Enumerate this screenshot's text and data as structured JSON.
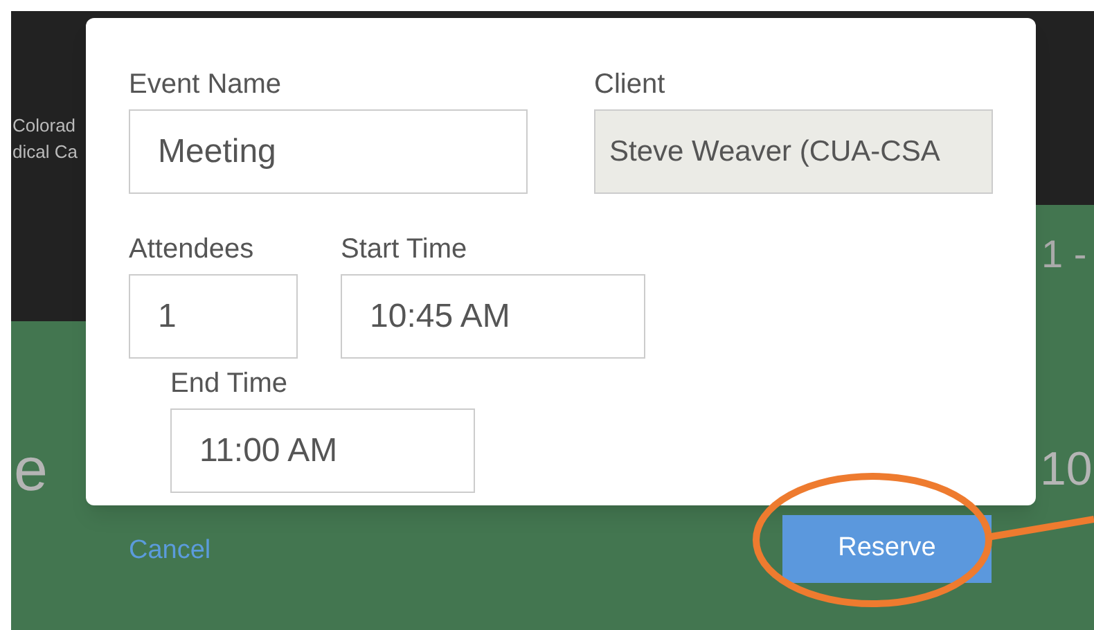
{
  "background": {
    "texts": [
      "Colorad",
      "dical Ca",
      "1 -",
      "e",
      "10"
    ]
  },
  "dialog": {
    "fields": [
      {
        "label": "Event Name",
        "value": "Meeting",
        "disabled": false
      },
      {
        "label": "Client",
        "value": "Steve Weaver (CUA-CSA",
        "disabled": true
      },
      {
        "label": "Attendees",
        "value": "1",
        "disabled": false
      },
      {
        "label": "Start Time",
        "value": "10:45 AM",
        "disabled": false
      },
      {
        "label": "End Time",
        "value": "11:00 AM",
        "disabled": false
      }
    ]
  },
  "actions": {
    "cancel": "Cancel",
    "reserve": "Reserve"
  }
}
